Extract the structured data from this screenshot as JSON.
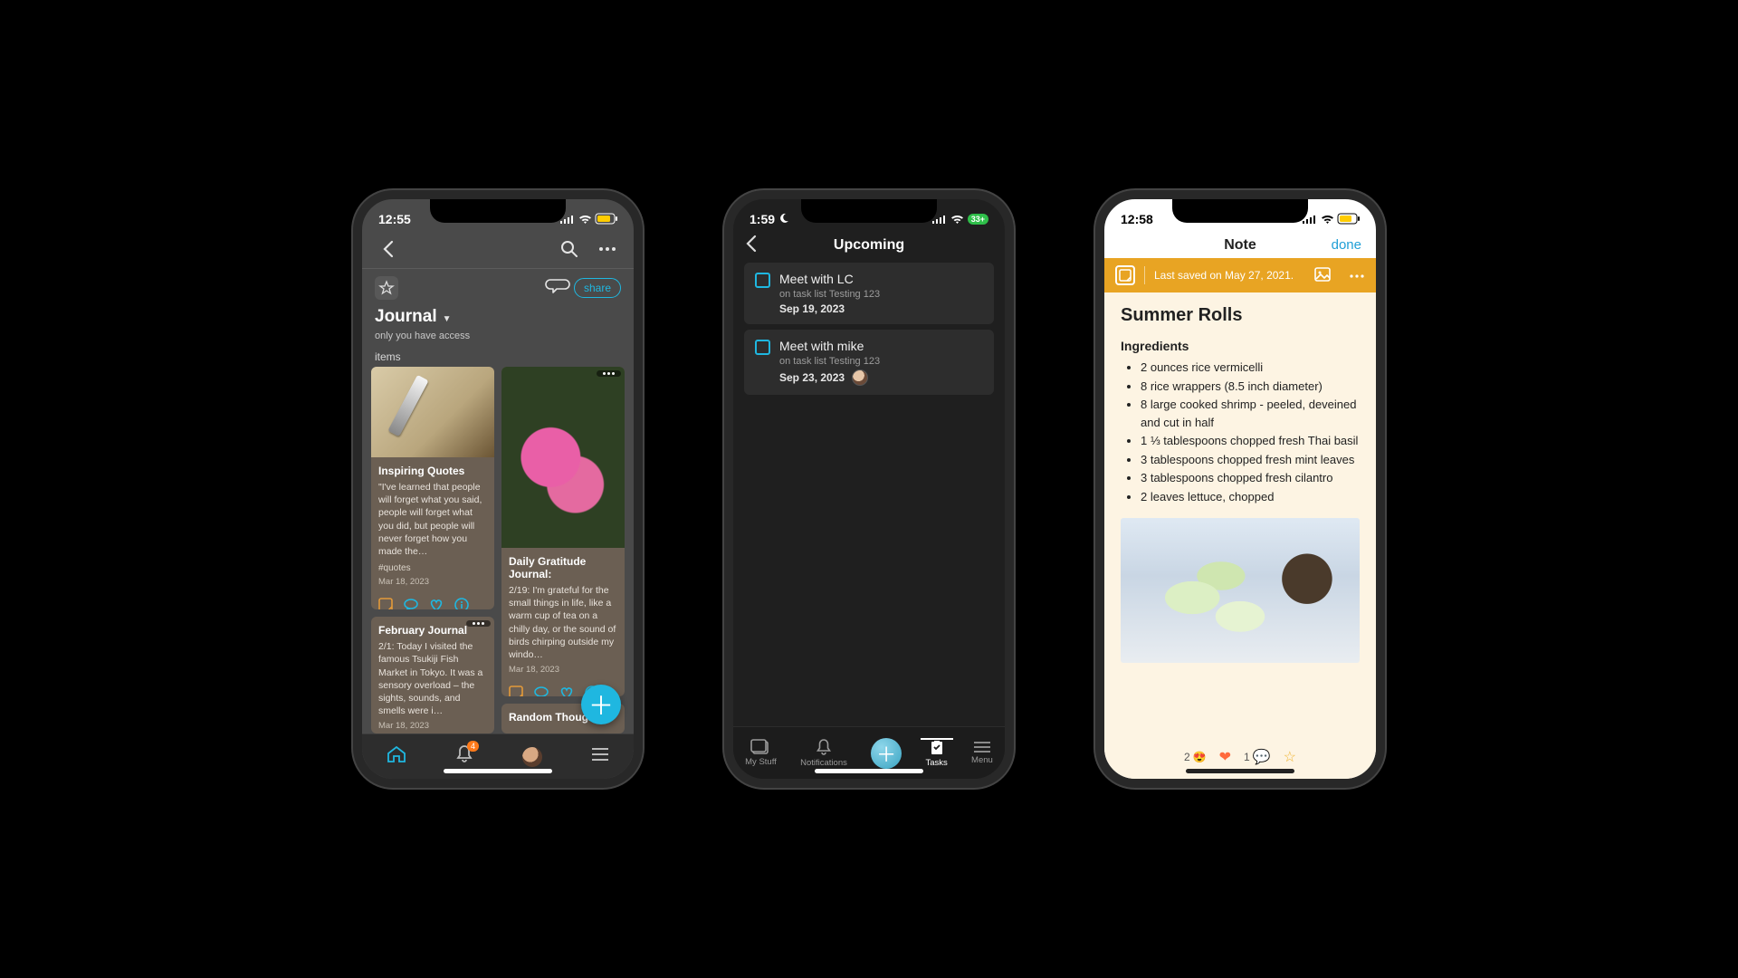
{
  "phone1": {
    "status_time": "12:55",
    "share_label": "share",
    "title": "Journal",
    "access": "only you have access",
    "section_label": "items",
    "cards": {
      "inspiring": {
        "title": "Inspiring Quotes",
        "body": "\"I've learned that people will forget what you said, people will forget what you did, but people will never forget how you made the…",
        "tag": "#quotes",
        "date": "Mar 18, 2023"
      },
      "february": {
        "title": "February Journal",
        "body": "2/1: Today I visited the famous Tsukiji Fish Market in Tokyo. It was a sensory overload – the sights, sounds, and smells were i…",
        "date": "Mar 18, 2023"
      },
      "gratitude": {
        "title": "Daily Gratitude Journal:",
        "body": "2/19: I'm grateful for the small things in life, like a warm cup of tea on a chilly day, or the sound of birds chirping outside my windo…",
        "date": "Mar 18, 2023"
      },
      "random": {
        "title": "Random Thoughts"
      }
    },
    "badge_count": "4"
  },
  "phone2": {
    "status_time": "1:59",
    "battery": "33+",
    "title": "Upcoming",
    "tasks": [
      {
        "title": "Meet with LC",
        "sub": "on task list Testing 123",
        "due": "Sep 19, 2023",
        "avatar": false
      },
      {
        "title": "Meet with mike",
        "sub": "on task list Testing 123",
        "due": "Sep 23, 2023",
        "avatar": true
      }
    ],
    "tabs": {
      "mystuff": "My Stuff",
      "notifications": "Notifications",
      "tasks": "Tasks",
      "menu": "Menu"
    }
  },
  "phone3": {
    "status_time": "12:58",
    "title": "Note",
    "done_label": "done",
    "banner_text": "Last saved on May 27, 2021.",
    "note_title": "Summer Rolls",
    "ingredients_label": "Ingredients",
    "ingredients": [
      "2 ounces rice vermicelli",
      "8 rice wrappers (8.5 inch diameter)",
      "8 large cooked shrimp - peeled, deveined and cut in half",
      "1 ⅓ tablespoons chopped fresh Thai basil",
      "3 tablespoons chopped fresh mint leaves",
      "3 tablespoons chopped fresh cilantro",
      "2 leaves lettuce, chopped"
    ],
    "reactions": {
      "heart_count": "2",
      "comment_count": "1"
    }
  }
}
